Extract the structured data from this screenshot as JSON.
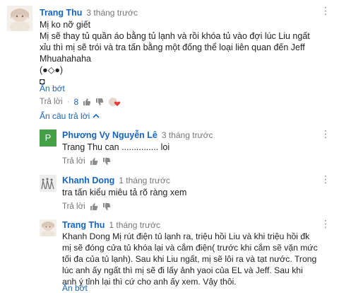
{
  "comments": {
    "main": {
      "author": "Trang Thu",
      "time": "3 tháng trước",
      "line1": "Mị ko nỡ giết",
      "line2": "Mị sẽ thay tủ quần áo bằng tủ lạnh và rồi khóa tủ vào đợi lúc Liu ngất",
      "line3": "xỉu thì mị sẽ trói và tra tấn bằng một đống thể loại liên quan đến Jeff",
      "line4": "Mhuahahaha",
      "line5": "(●◇●)",
      "line6": "◘",
      "collapse": "Ẩn bớt",
      "reply": "Trả lời",
      "likes": "8",
      "hide_replies": "Ẩn câu trả lời"
    },
    "replies": [
      {
        "author": "Phương Vy Nguyễn Lê",
        "time": "3 tháng trước",
        "avatar_letter": "P",
        "avatar_color": "#43a047",
        "text": "Trang Thu  can ............... loi",
        "reply": "Trả lời"
      },
      {
        "author": "Khanh Dong",
        "time": "1 tháng trước",
        "text": "tra tấn kiểu miêu tả rõ ràng xem",
        "reply": "Trả lời"
      },
      {
        "author": "Trang Thu",
        "time": "1 tháng trước",
        "line1": "Khanh Dong Mị rút điện tủ lạnh ra, triệu hồi Liu và khi triệu hồi đk",
        "line2": "mị sẽ đóng cửa tủ khóa lại và cắm điện( trước khi cắm sẽ vặn mức",
        "line3": "tối đa của tủ lạnh). Sau khi Liu ngất, mị sẽ lôi ra và tạt nước. Trong",
        "line4": "lúc anh ấy ngất thì mị sẽ đi lấy ảnh yaoi của EL và Jeff. Sau khi",
        "line5": "anh ý tỉnh lại thì cứ cho anh ấy xem. Vậy thôi.",
        "collapse": "Ẩn bớt"
      }
    ]
  },
  "colors": {
    "link": "#1565c0",
    "meta": "#767676",
    "heart": "#e53935"
  }
}
